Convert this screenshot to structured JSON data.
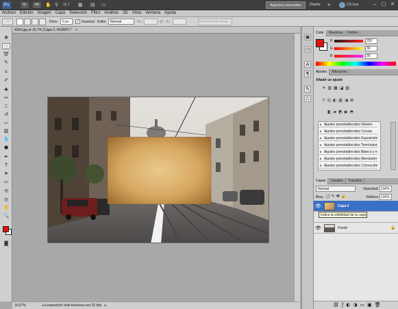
{
  "titlebar": {
    "app_logo": "Ps",
    "bridge": "Br",
    "minibridge": "Mb",
    "zoom": "16,7",
    "workspace_active": "Aspectos esenciales",
    "workspace_design": "Diseño",
    "more": "»",
    "cslive": "CS Live",
    "colors": {
      "bg": "#3f3f3f",
      "logo": "#3b5f8a",
      "active_workspace": "#6e6e6e"
    }
  },
  "menu": [
    "Archivo",
    "Edición",
    "Imagen",
    "Capa",
    "Selección",
    "Filtro",
    "Análisis",
    "3D",
    "Vista",
    "Ventana",
    "Ayuda"
  ],
  "options": {
    "feather_label": "Desv.:",
    "feather_value": "0 px",
    "antialias_label": "Suavizar",
    "antialias_checked": true,
    "style_label": "Estilo:",
    "style_value": "Normal",
    "width_label": "An.:",
    "height_label": "Al.:",
    "refine_button": "Perfeccionar borde..."
  },
  "document": {
    "tab_label": "4264.jpg al 16,7% (Capa 2, RGB/8*) *",
    "close": "×"
  },
  "status": {
    "zoom": "16,67%",
    "message": "La exposición sólo funciona con 32 bits"
  },
  "color_panel": {
    "tabs": [
      "Color",
      "Muestras",
      "Estilos"
    ],
    "channels": [
      {
        "label": "R",
        "value": "252"
      },
      {
        "label": "G",
        "value": "30"
      },
      {
        "label": "B",
        "value": "30"
      }
    ],
    "foreground": "#e01010",
    "background": "#ffffff"
  },
  "adjust_panel": {
    "tabs": [
      "Ajustes",
      "Máscaras"
    ],
    "title": "Añadir un ajuste",
    "presets": [
      "Ajustes preestablecidos Niveles",
      "Ajustes preestablecidos Curvas",
      "Ajustes preestablecidos Exposición",
      "Ajustes preestablecidos Tono/satur...",
      "Ajustes preestablecidos Blanco y ne...",
      "Ajustes preestablecidos Mezclador ...",
      "Ajustes preestablecidos Corrección ..."
    ]
  },
  "layers_panel": {
    "tabs": [
      "Capas",
      "Canales",
      "Trazados"
    ],
    "blend_mode": "Normal",
    "opacity_label": "Opacidad:",
    "opacity_value": "100%",
    "lock_label": "Bloq.:",
    "fill_label": "Relleno:",
    "fill_value": "100%",
    "layers": [
      {
        "name": "Capa 2",
        "selected": true,
        "visible": true
      },
      {
        "name": "Fondo",
        "selected": false,
        "visible": true
      }
    ],
    "tooltip": "Indica la visibilidad de la capa",
    "selection_color": "#3a6fc6"
  }
}
